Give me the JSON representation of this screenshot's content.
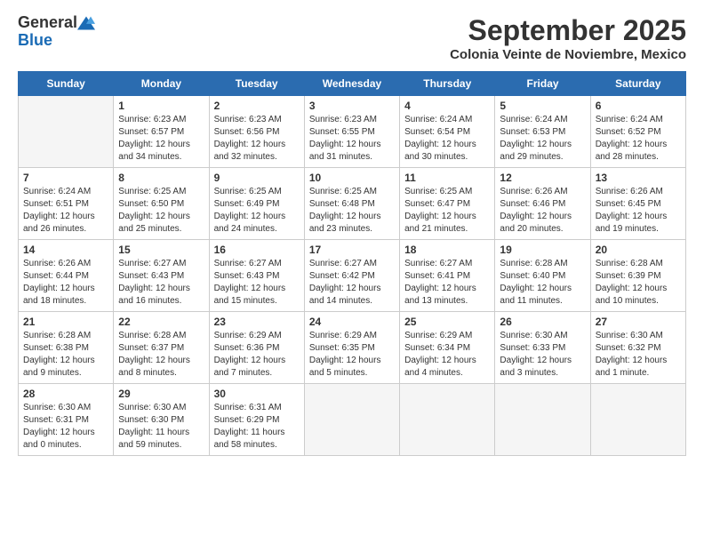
{
  "logo": {
    "general": "General",
    "blue": "Blue"
  },
  "title": "September 2025",
  "subtitle": "Colonia Veinte de Noviembre, Mexico",
  "days_of_week": [
    "Sunday",
    "Monday",
    "Tuesday",
    "Wednesday",
    "Thursday",
    "Friday",
    "Saturday"
  ],
  "weeks": [
    [
      {
        "day": "",
        "content": ""
      },
      {
        "day": "1",
        "content": "Sunrise: 6:23 AM\nSunset: 6:57 PM\nDaylight: 12 hours\nand 34 minutes."
      },
      {
        "day": "2",
        "content": "Sunrise: 6:23 AM\nSunset: 6:56 PM\nDaylight: 12 hours\nand 32 minutes."
      },
      {
        "day": "3",
        "content": "Sunrise: 6:23 AM\nSunset: 6:55 PM\nDaylight: 12 hours\nand 31 minutes."
      },
      {
        "day": "4",
        "content": "Sunrise: 6:24 AM\nSunset: 6:54 PM\nDaylight: 12 hours\nand 30 minutes."
      },
      {
        "day": "5",
        "content": "Sunrise: 6:24 AM\nSunset: 6:53 PM\nDaylight: 12 hours\nand 29 minutes."
      },
      {
        "day": "6",
        "content": "Sunrise: 6:24 AM\nSunset: 6:52 PM\nDaylight: 12 hours\nand 28 minutes."
      }
    ],
    [
      {
        "day": "7",
        "content": "Sunrise: 6:24 AM\nSunset: 6:51 PM\nDaylight: 12 hours\nand 26 minutes."
      },
      {
        "day": "8",
        "content": "Sunrise: 6:25 AM\nSunset: 6:50 PM\nDaylight: 12 hours\nand 25 minutes."
      },
      {
        "day": "9",
        "content": "Sunrise: 6:25 AM\nSunset: 6:49 PM\nDaylight: 12 hours\nand 24 minutes."
      },
      {
        "day": "10",
        "content": "Sunrise: 6:25 AM\nSunset: 6:48 PM\nDaylight: 12 hours\nand 23 minutes."
      },
      {
        "day": "11",
        "content": "Sunrise: 6:25 AM\nSunset: 6:47 PM\nDaylight: 12 hours\nand 21 minutes."
      },
      {
        "day": "12",
        "content": "Sunrise: 6:26 AM\nSunset: 6:46 PM\nDaylight: 12 hours\nand 20 minutes."
      },
      {
        "day": "13",
        "content": "Sunrise: 6:26 AM\nSunset: 6:45 PM\nDaylight: 12 hours\nand 19 minutes."
      }
    ],
    [
      {
        "day": "14",
        "content": "Sunrise: 6:26 AM\nSunset: 6:44 PM\nDaylight: 12 hours\nand 18 minutes."
      },
      {
        "day": "15",
        "content": "Sunrise: 6:27 AM\nSunset: 6:43 PM\nDaylight: 12 hours\nand 16 minutes."
      },
      {
        "day": "16",
        "content": "Sunrise: 6:27 AM\nSunset: 6:43 PM\nDaylight: 12 hours\nand 15 minutes."
      },
      {
        "day": "17",
        "content": "Sunrise: 6:27 AM\nSunset: 6:42 PM\nDaylight: 12 hours\nand 14 minutes."
      },
      {
        "day": "18",
        "content": "Sunrise: 6:27 AM\nSunset: 6:41 PM\nDaylight: 12 hours\nand 13 minutes."
      },
      {
        "day": "19",
        "content": "Sunrise: 6:28 AM\nSunset: 6:40 PM\nDaylight: 12 hours\nand 11 minutes."
      },
      {
        "day": "20",
        "content": "Sunrise: 6:28 AM\nSunset: 6:39 PM\nDaylight: 12 hours\nand 10 minutes."
      }
    ],
    [
      {
        "day": "21",
        "content": "Sunrise: 6:28 AM\nSunset: 6:38 PM\nDaylight: 12 hours\nand 9 minutes."
      },
      {
        "day": "22",
        "content": "Sunrise: 6:28 AM\nSunset: 6:37 PM\nDaylight: 12 hours\nand 8 minutes."
      },
      {
        "day": "23",
        "content": "Sunrise: 6:29 AM\nSunset: 6:36 PM\nDaylight: 12 hours\nand 7 minutes."
      },
      {
        "day": "24",
        "content": "Sunrise: 6:29 AM\nSunset: 6:35 PM\nDaylight: 12 hours\nand 5 minutes."
      },
      {
        "day": "25",
        "content": "Sunrise: 6:29 AM\nSunset: 6:34 PM\nDaylight: 12 hours\nand 4 minutes."
      },
      {
        "day": "26",
        "content": "Sunrise: 6:30 AM\nSunset: 6:33 PM\nDaylight: 12 hours\nand 3 minutes."
      },
      {
        "day": "27",
        "content": "Sunrise: 6:30 AM\nSunset: 6:32 PM\nDaylight: 12 hours\nand 1 minute."
      }
    ],
    [
      {
        "day": "28",
        "content": "Sunrise: 6:30 AM\nSunset: 6:31 PM\nDaylight: 12 hours\nand 0 minutes."
      },
      {
        "day": "29",
        "content": "Sunrise: 6:30 AM\nSunset: 6:30 PM\nDaylight: 11 hours\nand 59 minutes."
      },
      {
        "day": "30",
        "content": "Sunrise: 6:31 AM\nSunset: 6:29 PM\nDaylight: 11 hours\nand 58 minutes."
      },
      {
        "day": "",
        "content": ""
      },
      {
        "day": "",
        "content": ""
      },
      {
        "day": "",
        "content": ""
      },
      {
        "day": "",
        "content": ""
      }
    ]
  ]
}
